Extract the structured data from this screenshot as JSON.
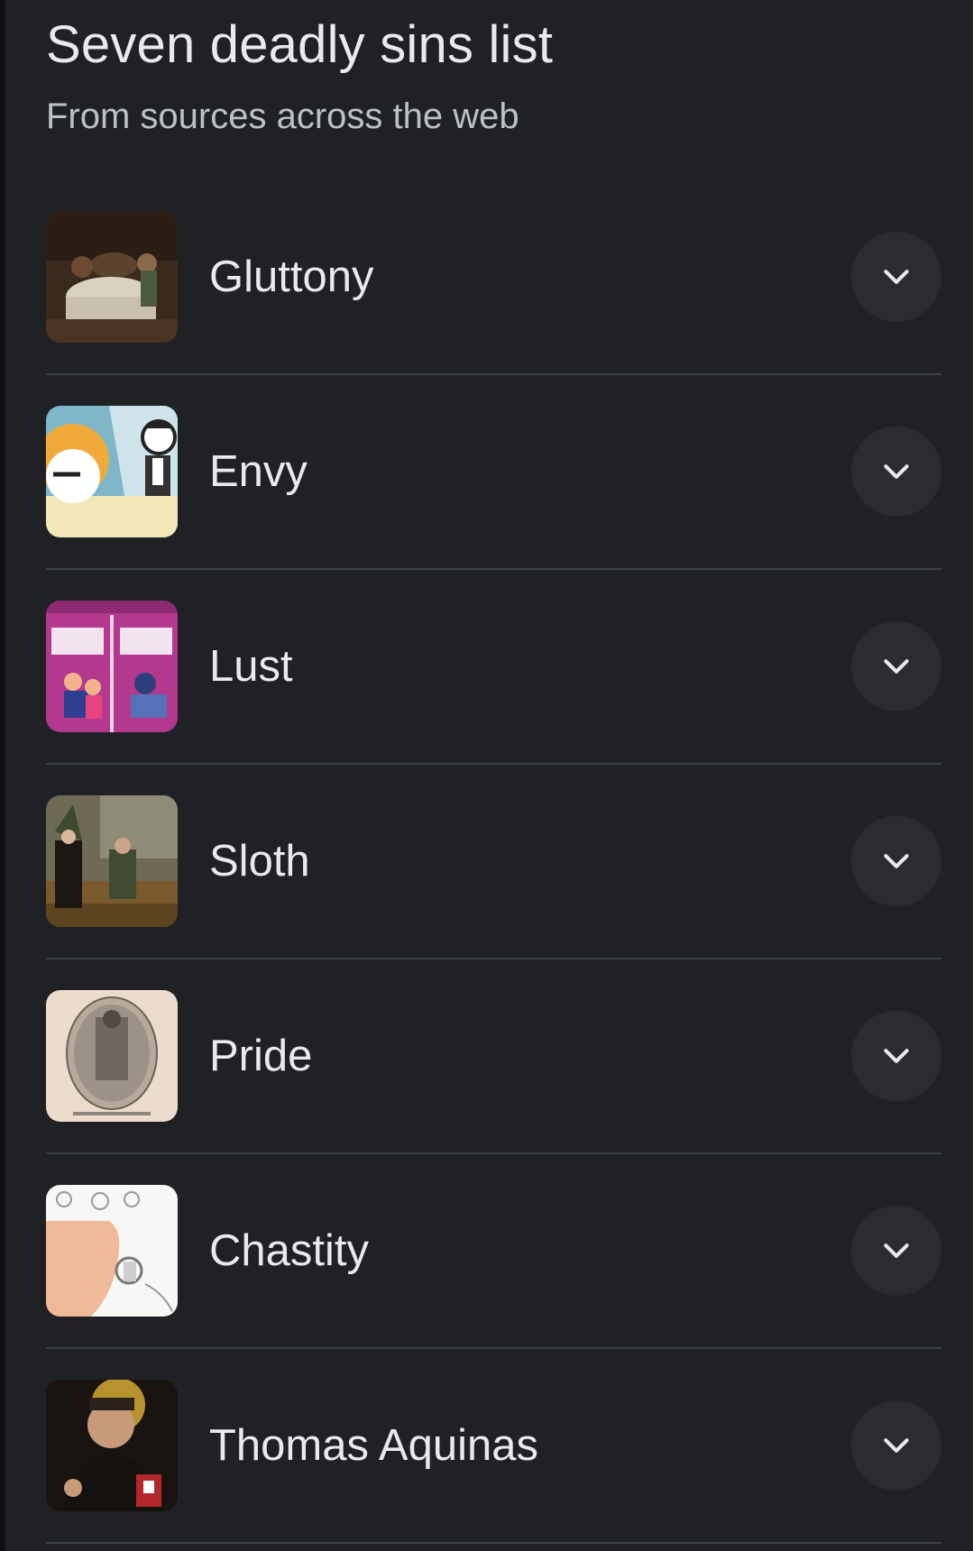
{
  "header": {
    "title": "Seven deadly sins list",
    "subtitle": "From sources across the web"
  },
  "items": [
    {
      "label": "Gluttony",
      "thumb": "gluttony-painting"
    },
    {
      "label": "Envy",
      "thumb": "envy-cartoon"
    },
    {
      "label": "Lust",
      "thumb": "lust-infographic"
    },
    {
      "label": "Sloth",
      "thumb": "sloth-painting"
    },
    {
      "label": "Pride",
      "thumb": "pride-engraving"
    },
    {
      "label": "Chastity",
      "thumb": "chastity-diagram"
    },
    {
      "label": "Thomas Aquinas",
      "thumb": "thomas-aquinas-portrait"
    }
  ],
  "icons": {
    "expand": "chevron-down-icon"
  },
  "colors": {
    "background": "#1f2125",
    "text": "#e8eaed",
    "subtext": "#bdc1c6",
    "divider": "#3c4043",
    "button": "#2a2c31"
  }
}
